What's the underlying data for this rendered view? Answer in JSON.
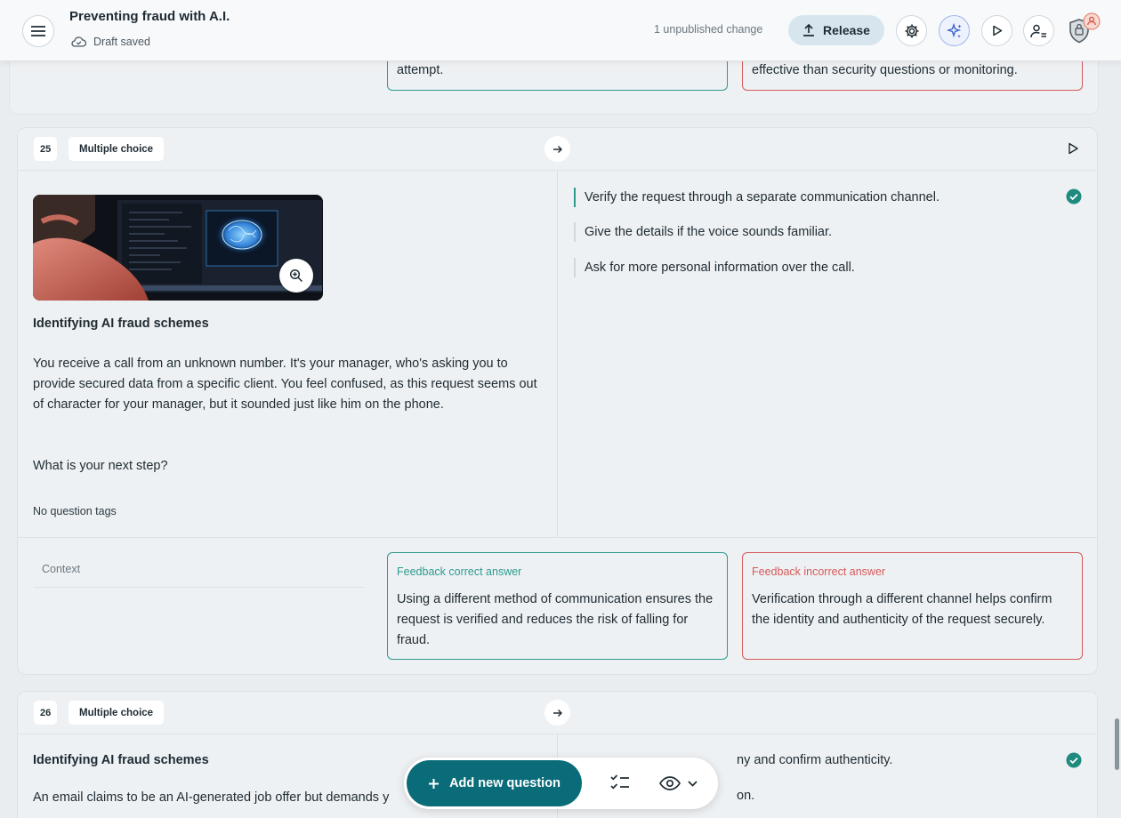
{
  "header": {
    "title": "Preventing fraud with A.I.",
    "draft_status": "Draft saved",
    "unpublished": "1 unpublished change",
    "release_label": "Release"
  },
  "prev_card": {
    "feedback_correct_tail": "attempt.",
    "feedback_incorrect_tail": "effective than security questions or monitoring."
  },
  "questions": [
    {
      "number": "25",
      "type": "Multiple choice",
      "title": "Identifying AI fraud schemes",
      "body": "You receive a call from an unknown number. It's your manager, who's asking you to provide secured data from a specific client. You feel confused, as this request seems out of character for your manager, but it sounded just like him on the phone.",
      "prompt": "What is your next step?",
      "tags": "No question tags",
      "answers": [
        {
          "text": "Verify the request through a separate communication channel.",
          "correct": true
        },
        {
          "text": "Give the details if the voice sounds familiar.",
          "correct": false
        },
        {
          "text": "Ask for more personal information over the call.",
          "correct": false
        }
      ],
      "context_label": "Context",
      "feedback_correct_label": "Feedback correct answer",
      "feedback_correct": "Using a different method of communication ensures the request is verified and reduces the risk of falling for fraud.",
      "feedback_incorrect_label": "Feedback incorrect answer",
      "feedback_incorrect": "Verification through a different channel helps confirm the identity and authenticity of the request securely."
    },
    {
      "number": "26",
      "type": "Multiple choice",
      "title": "Identifying AI fraud schemes",
      "body_partial": "An email claims to be an AI-generated job offer but demands y",
      "answers_partial": [
        {
          "text": "ny and confirm authenticity.",
          "correct": true
        },
        {
          "text": "on.",
          "correct": false
        }
      ]
    }
  ],
  "toolbar": {
    "add_label": "Add new question"
  },
  "colors": {
    "accent": "#0b6c79",
    "correct": "#2e9a8e",
    "incorrect": "#d45a5a"
  }
}
